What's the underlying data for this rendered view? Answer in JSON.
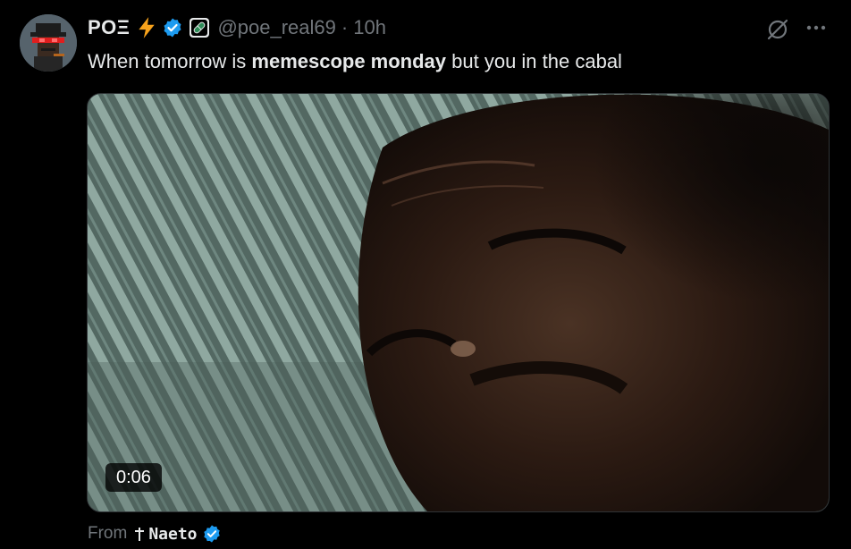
{
  "post": {
    "author_name": "POΞ",
    "author_handle": "@poe_real69",
    "separator": "·",
    "timestamp": "10h",
    "text_parts": {
      "before": "When tomorrow is ",
      "bold": "memescope monday",
      "after": " but you in the cabal"
    }
  },
  "media": {
    "type": "video",
    "duration": "0:06"
  },
  "attribution": {
    "prefix": "From",
    "source_name": "Naeto"
  },
  "icons": {
    "header_badges": [
      "lightning-bolt-icon",
      "verified-badge-icon",
      "pill-badge-icon"
    ],
    "actions": [
      "grok-icon",
      "more-options-icon"
    ],
    "attribution": [
      "dagger-icon",
      "verified-badge-icon"
    ]
  },
  "colors": {
    "background": "#000000",
    "text_primary": "#e7e9ea",
    "text_secondary": "#71767b",
    "verified_blue": "#1d9bf0",
    "bolt_orange": "#f7a21b"
  }
}
